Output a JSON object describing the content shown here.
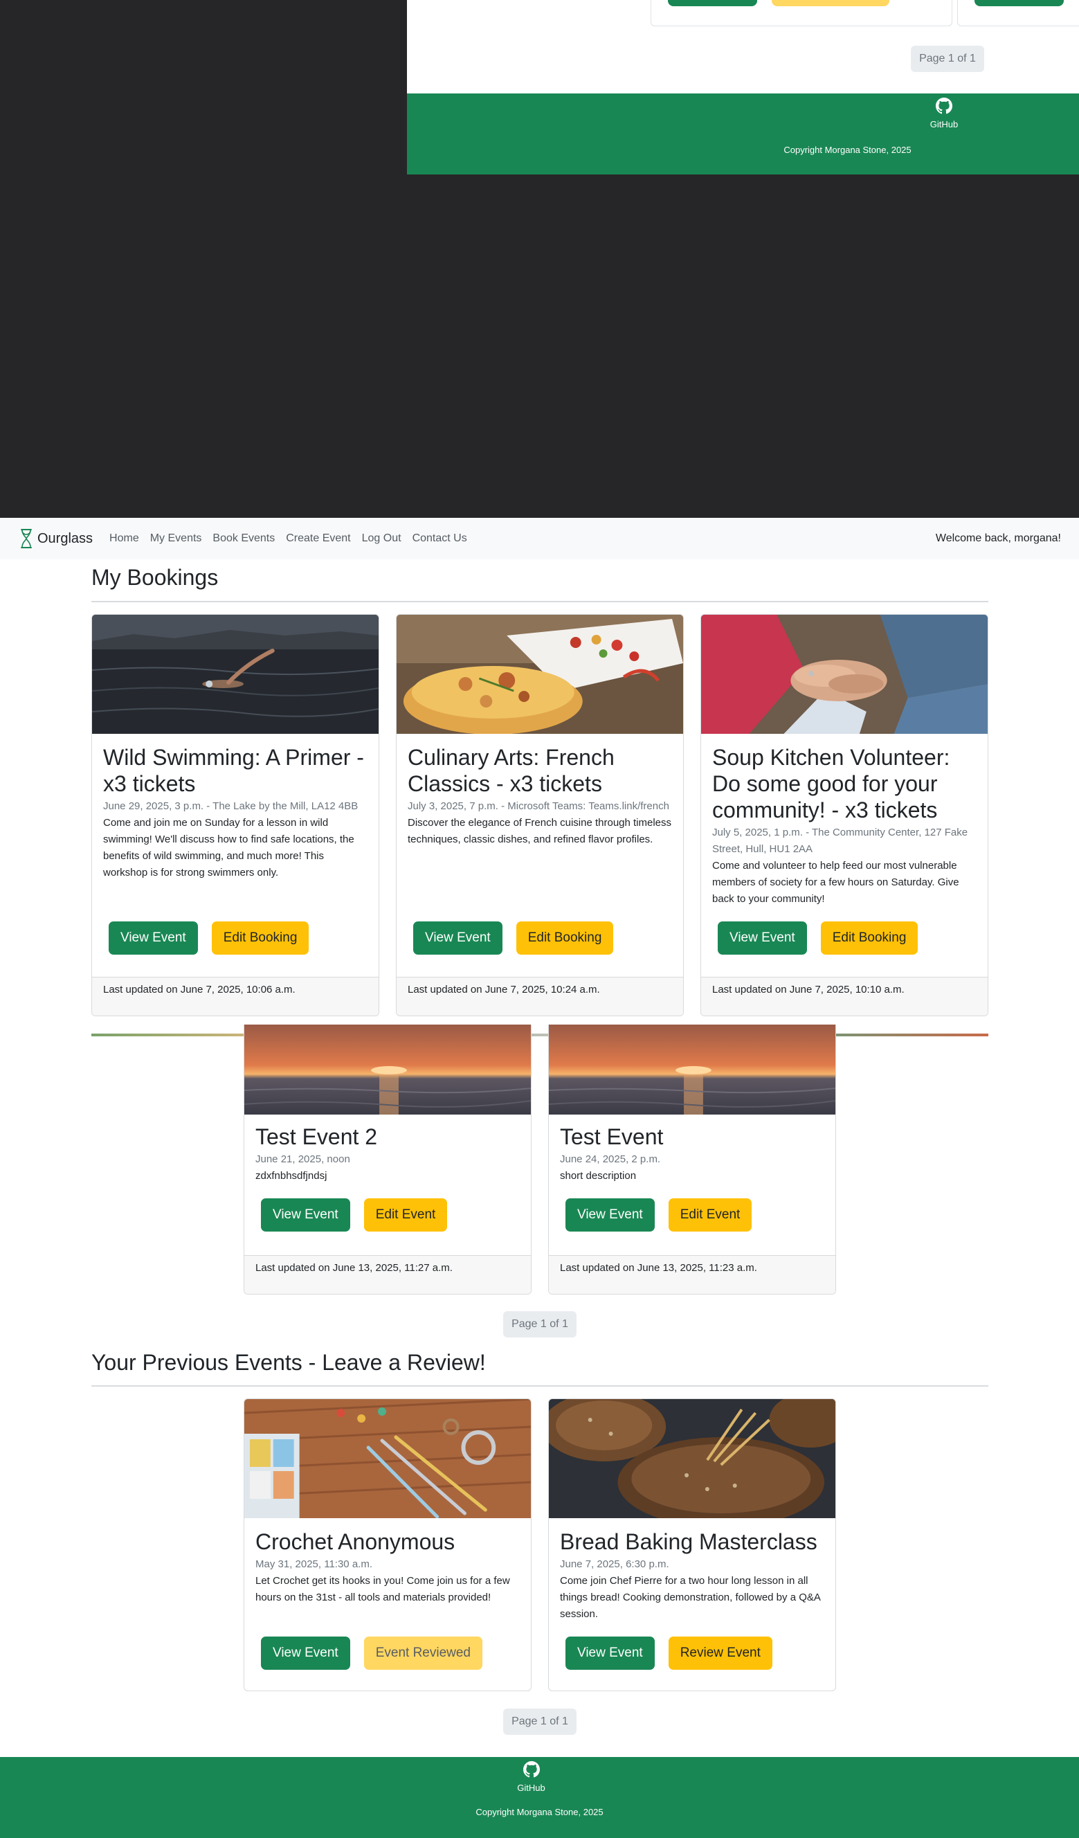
{
  "ghost": {
    "pager_text": "Page 1 of 1",
    "github_label": "GitHub",
    "copyright": "Copyright Morgana Stone, 2025"
  },
  "navbar": {
    "brand": "Ourglass",
    "links": [
      "Home",
      "My Events",
      "Book Events",
      "Create Event",
      "Log Out",
      "Contact Us"
    ],
    "welcome": "Welcome back, morgana!"
  },
  "bookings": {
    "title": "My Bookings",
    "cards": [
      {
        "title": "Wild Swimming: A Primer - x3 tickets",
        "meta": "June 29, 2025, 3 p.m. - The Lake by the Mill, LA12 4BB",
        "description": "Come and join me on Sunday for a lesson in wild swimming! We'll discuss how to find safe locations, the benefits of wild swimming, and much more! This workshop is for strong swimmers only.",
        "btn_view": "View Event",
        "btn_edit": "Edit Booking",
        "footer": "Last updated on June 7, 2025, 10:06 a.m."
      },
      {
        "title": "Culinary Arts: French Classics - x3 tickets",
        "meta": "July 3, 2025, 7 p.m. - Microsoft Teams: Teams.link/french",
        "description": "Discover the elegance of French cuisine through timeless techniques, classic dishes, and refined flavor profiles.",
        "btn_view": "View Event",
        "btn_edit": "Edit Booking",
        "footer": "Last updated on June 7, 2025, 10:24 a.m."
      },
      {
        "title": "Soup Kitchen Volunteer: Do some good for your community! - x3 tickets",
        "meta": "July 5, 2025, 1 p.m. - The Community Center, 127 Fake Street, Hull, HU1 2AA",
        "description": "Come and volunteer to help feed our most vulnerable members of society for a few hours on Saturday. Give back to your community!",
        "btn_view": "View Event",
        "btn_edit": "Edit Booking",
        "footer": "Last updated on June 7, 2025, 10:10 a.m."
      }
    ]
  },
  "my_events": {
    "cards": [
      {
        "title": "Test Event 2",
        "meta": "June 21, 2025, noon",
        "description": "zdxfnbhsdfjndsj",
        "btn_view": "View Event",
        "btn_edit": "Edit Event",
        "footer": "Last updated on June 13, 2025, 11:27 a.m."
      },
      {
        "title": "Test Event",
        "meta": "June 24, 2025, 2 p.m.",
        "description": "short description",
        "btn_view": "View Event",
        "btn_edit": "Edit Event",
        "footer": "Last updated on June 13, 2025, 11:23 a.m."
      }
    ],
    "pager_text": "Page 1 of 1"
  },
  "previous": {
    "title": "Your Previous Events - Leave a Review!",
    "cards": [
      {
        "title": "Crochet Anonymous",
        "meta": "May 31, 2025, 11:30 a.m.",
        "description": "Let Crochet get its hooks in you! Come join us for a few hours on the 31st - all tools and materials provided!",
        "btn_view": "View Event",
        "btn_review": "Event Reviewed"
      },
      {
        "title": "Bread Baking Masterclass",
        "meta": "June 7, 2025, 6:30 p.m.",
        "description": "Come join Chef Pierre for a two hour long lesson in all things bread! Cooking demonstration, followed by a Q&A session.",
        "btn_view": "View Event",
        "btn_review": "Review Event"
      }
    ],
    "pager_text": "Page 1 of 1"
  },
  "footer": {
    "github_label": "GitHub",
    "copyright": "Copyright Morgana Stone, 2025"
  },
  "colors": {
    "primary_green": "#198754",
    "warning_yellow": "#ffc107",
    "navbar_bg": "#f8f9fa",
    "dark_region": "#262628"
  }
}
